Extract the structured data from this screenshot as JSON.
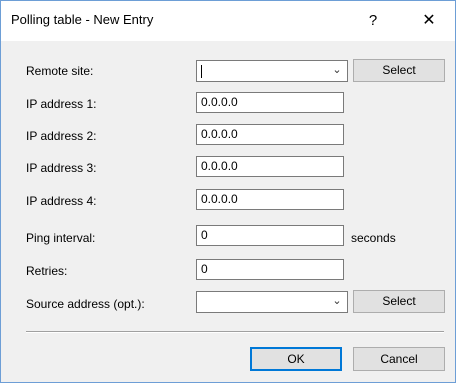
{
  "window": {
    "title": "Polling table - New Entry",
    "help_label": "?",
    "close_label": "✕"
  },
  "form": {
    "remote_site": {
      "label": "Remote site:",
      "value": "",
      "select_button": "Select"
    },
    "ip1": {
      "label": "IP address 1:",
      "value": "0.0.0.0"
    },
    "ip2": {
      "label": "IP address 2:",
      "value": "0.0.0.0"
    },
    "ip3": {
      "label": "IP address 3:",
      "value": "0.0.0.0"
    },
    "ip4": {
      "label": "IP address 4:",
      "value": "0.0.0.0"
    },
    "ping_interval": {
      "label": "Ping interval:",
      "value": "0",
      "unit": "seconds"
    },
    "retries": {
      "label": "Retries:",
      "value": "0"
    },
    "source_address": {
      "label": "Source address (opt.):",
      "value": "",
      "select_button": "Select"
    }
  },
  "footer": {
    "ok_label": "OK",
    "cancel_label": "Cancel"
  },
  "colors": {
    "dialog_bg": "#f0f0f0",
    "titlebar_bg": "#ffffff",
    "accent": "#0078d7",
    "window_border": "#6d9ed6"
  },
  "icons": {
    "dropdown": "chevron-down-icon",
    "close": "close-icon",
    "help": "help-icon"
  }
}
